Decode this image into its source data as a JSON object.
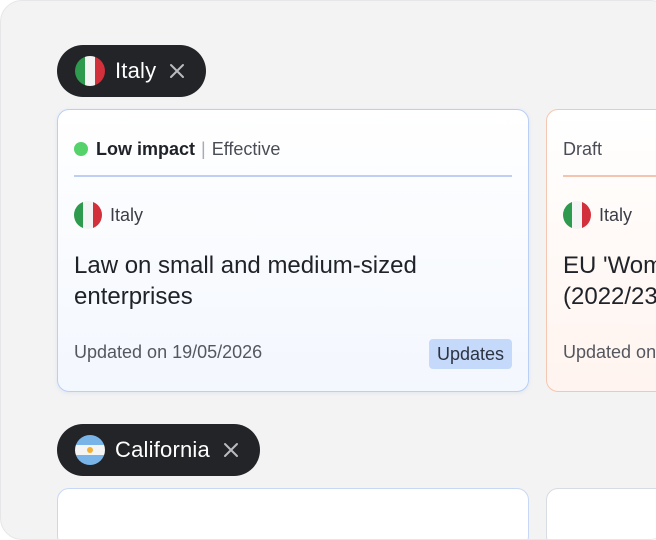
{
  "groups": [
    {
      "chip_label": "Italy",
      "flag_icon": "italy-flag-icon",
      "close_icon": "close-icon"
    },
    {
      "chip_label": "California",
      "flag_icon": "california-flag-icon",
      "close_icon": "close-icon"
    }
  ],
  "cards": [
    {
      "impact": "Low impact",
      "impact_color": "#55d36a",
      "separator": "|",
      "status": "Effective",
      "country": "Italy",
      "title": "Law on small and medium-sized\nenterprises",
      "updated": "Updated on 19/05/2026",
      "tag": "Updates"
    },
    {
      "status": "Draft",
      "country": "Italy",
      "title": "EU 'Wom\n(2022/23",
      "updated": "Updated on"
    }
  ]
}
